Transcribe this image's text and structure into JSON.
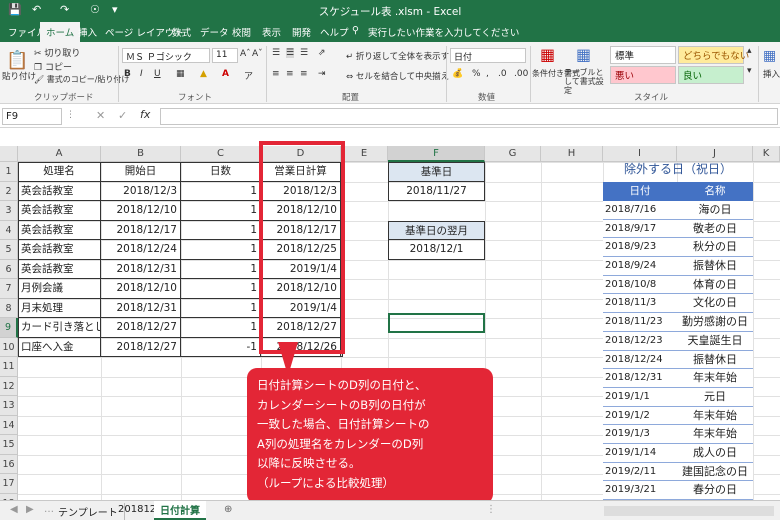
{
  "title": "スケジュール表 .xlsm - Excel",
  "tabs": [
    "ファイル",
    "ホーム",
    "挿入",
    "ページ レイアウト",
    "数式",
    "データ",
    "校閲",
    "表示",
    "開発",
    "ヘルプ"
  ],
  "tellme": "実行したい作業を入力してください",
  "ribbon": {
    "cut": "切り取り",
    "copy": "コピー",
    "format_painter": "書式のコピー/貼り付け",
    "paste": "貼り付け",
    "clipboard": "クリップボード",
    "font": "フォント",
    "alignment": "配置",
    "number": "数値",
    "styles": "スタイル",
    "font_name": "ＭＳ Ｐゴシック",
    "font_size": "11",
    "wrap_text": "折り返して全体を表示する",
    "merge": "セルを結合して中央揃え",
    "number_format": "日付",
    "conditional": "条件付き書式",
    "table_format": "テーブルとして書式設定",
    "style_normal": "標準",
    "style_neutral": "どちらでもない",
    "style_bad": "悪い",
    "style_good": "良い",
    "insert": "挿入"
  },
  "name_box": "F9",
  "columns": [
    "A",
    "B",
    "C",
    "D",
    "E",
    "F",
    "G",
    "H",
    "I",
    "J",
    "K"
  ],
  "rows": [
    "1",
    "2",
    "3",
    "4",
    "5",
    "6",
    "7",
    "8",
    "9",
    "10",
    "11",
    "12",
    "13",
    "14",
    "15",
    "16",
    "17",
    "18"
  ],
  "table": {
    "headers": [
      "処理名",
      "開始日",
      "日数",
      "営業日計算"
    ],
    "rows": [
      [
        "英会話教室",
        "2018/12/3",
        "1",
        "2018/12/3"
      ],
      [
        "英会話教室",
        "2018/12/10",
        "1",
        "2018/12/10"
      ],
      [
        "英会話教室",
        "2018/12/17",
        "1",
        "2018/12/17"
      ],
      [
        "英会話教室",
        "2018/12/24",
        "1",
        "2018/12/25"
      ],
      [
        "英会話教室",
        "2018/12/31",
        "1",
        "2019/1/4"
      ],
      [
        "月例会議",
        "2018/12/10",
        "1",
        "2018/12/10"
      ],
      [
        "月末処理",
        "2018/12/31",
        "1",
        "2019/1/4"
      ],
      [
        "カード引き落とし",
        "2018/12/27",
        "1",
        "2018/12/27"
      ],
      [
        "口座へ入金",
        "2018/12/27",
        "-1",
        "2018/12/26"
      ]
    ]
  },
  "base": {
    "label": "基準日",
    "value": "2018/11/27",
    "next_label": "基準日の翌月",
    "next_value": "2018/12/1"
  },
  "holidays": {
    "title": "除外する日（祝日）",
    "col_date": "日付",
    "col_name": "名称",
    "rows": [
      [
        "2018/7/16",
        "海の日"
      ],
      [
        "2018/9/17",
        "敬老の日"
      ],
      [
        "2018/9/23",
        "秋分の日"
      ],
      [
        "2018/9/24",
        "振替休日"
      ],
      [
        "2018/10/8",
        "体育の日"
      ],
      [
        "2018/11/3",
        "文化の日"
      ],
      [
        "2018/11/23",
        "勤労感謝の日"
      ],
      [
        "2018/12/23",
        "天皇誕生日"
      ],
      [
        "2018/12/24",
        "振替休日"
      ],
      [
        "2018/12/31",
        "年末年始"
      ],
      [
        "2019/1/1",
        "元日"
      ],
      [
        "2019/1/2",
        "年末年始"
      ],
      [
        "2019/1/3",
        "年末年始"
      ],
      [
        "2019/1/14",
        "成人の日"
      ],
      [
        "2019/2/11",
        "建国記念の日"
      ],
      [
        "2019/3/21",
        "春分の日"
      ]
    ]
  },
  "callout": [
    "日付計算シートのD列の日付と、",
    "カレンダーシートのB列の日付が",
    "一致した場合、日付計算シートの",
    "A列の処理名をカレンダーのD列",
    "以降に反映させる。",
    "（ループによる比較処理）"
  ],
  "sheets": [
    "テンプレート",
    "201812",
    "日付計算"
  ],
  "colors": {
    "excel_green": "#217346",
    "header_blue": "#4472c4",
    "callout_red": "#e32636"
  }
}
